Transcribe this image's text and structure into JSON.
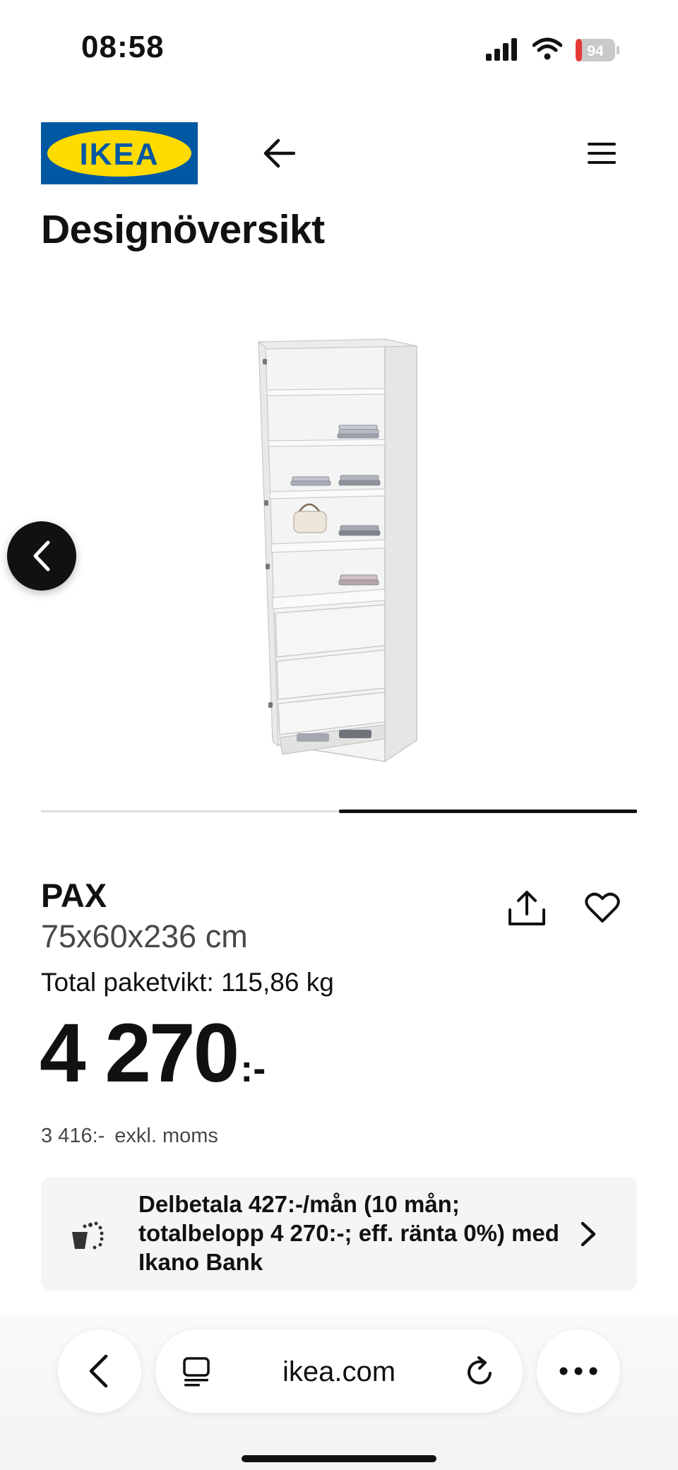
{
  "status_bar": {
    "time": "08:58",
    "battery": "94",
    "icons": [
      "cellular-signal-icon",
      "wifi-icon",
      "battery-icon"
    ]
  },
  "header": {
    "logo_text": "IKEA",
    "logo_colors": {
      "background": "#0058a3",
      "oval": "#ffdb00",
      "text": "#0058a3"
    },
    "icons": [
      "back-arrow-icon",
      "hamburger-menu-icon"
    ]
  },
  "page": {
    "title": "Designöversikt"
  },
  "carousel": {
    "prev_icon": "chevron-left-icon",
    "progress": 0.5
  },
  "product": {
    "name": "PAX",
    "dimensions": "75x60x236 cm",
    "weight_label": "Total paketvikt:",
    "weight_value": "115,86 kg",
    "price": "4 270",
    "price_suffix": ":-",
    "price_excl_value": "3 416:-",
    "price_excl_label": "exkl. moms",
    "actions": [
      "share-icon",
      "heart-icon"
    ]
  },
  "installment": {
    "text": "Delbetala 427:-/mån (10 mån; totalbelopp 4 270:-; eff. ränta 0%) med Ikano Bank",
    "icon": "coin-bag-icon"
  },
  "browser": {
    "url": "ikea.com",
    "icons": [
      "browser-back-icon",
      "reader-mode-icon",
      "reload-icon",
      "more-dots-icon"
    ]
  },
  "colors": {
    "accent": "#0058a3",
    "yellow": "#ffdb00",
    "text": "#111111",
    "muted": "#484848",
    "card": "#f5f5f5"
  }
}
